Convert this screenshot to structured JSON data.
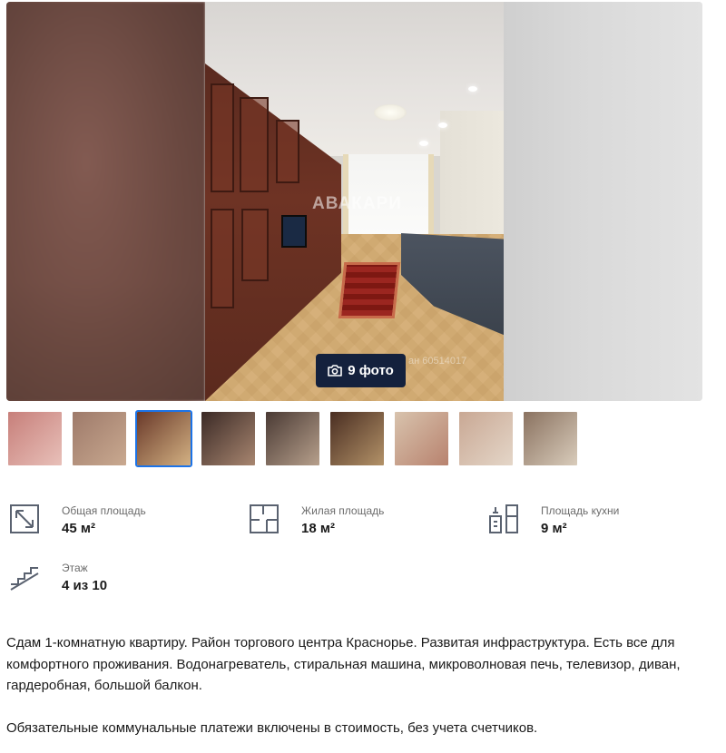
{
  "gallery": {
    "photo_button_label": "9 фото",
    "watermark": "АВАКАРИ",
    "watermark_secondary": "ан 60514017",
    "thumbnails": [
      {
        "colors": [
          "#c77f7a",
          "#e8c0b9"
        ]
      },
      {
        "colors": [
          "#9e7a6a",
          "#c9a990"
        ]
      },
      {
        "colors": [
          "#6a3a2a",
          "#d3b183"
        ]
      },
      {
        "colors": [
          "#3b2a26",
          "#a88670"
        ]
      },
      {
        "colors": [
          "#4a3a34",
          "#b7a08c"
        ]
      },
      {
        "colors": [
          "#4a2e22",
          "#b39268"
        ]
      },
      {
        "colors": [
          "#d8c3ad",
          "#b8826e"
        ]
      },
      {
        "colors": [
          "#c9a894",
          "#e4d6c8"
        ]
      },
      {
        "colors": [
          "#8a7260",
          "#d9ccbb"
        ]
      }
    ],
    "active_thumbnail": 2
  },
  "params": {
    "total_area": {
      "label": "Общая площадь",
      "value": "45 м²",
      "icon": "expand-arrow-icon"
    },
    "living_area": {
      "label": "Жилая площадь",
      "value": "18 м²",
      "icon": "floorplan-icon"
    },
    "kitchen_area": {
      "label": "Площадь кухни",
      "value": "9 м²",
      "icon": "kitchen-icon"
    },
    "floor": {
      "label": "Этаж",
      "value": "4 из 10",
      "icon": "stairs-icon"
    }
  },
  "description": {
    "paragraph1": "Сдам 1-комнатную квартиру. Район торгового центра Краснорье. Развитая инфраструктура. Есть все для комфортного проживания. Водонагреватель, стиральная машина, микроволновая печь, телевизор, диван, гардеробная, большой балкон.",
    "paragraph2": "Обязательные коммунальные платежи включены в стоимость, без учета счетчиков."
  },
  "colors": {
    "button_bg": "#14213d",
    "active_thumb_border": "#1b73e8",
    "icon_stroke": "#5a6270",
    "label_text": "#6b6b6b"
  }
}
